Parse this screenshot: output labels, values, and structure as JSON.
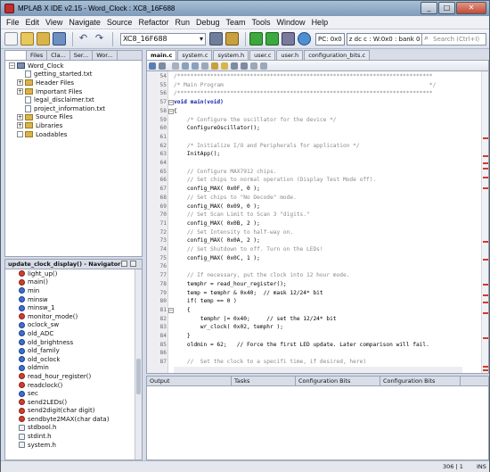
{
  "window": {
    "title": "MPLAB X IDE v2.15 - Word_Clock : XC8_16F688"
  },
  "menu": [
    "File",
    "Edit",
    "View",
    "Navigate",
    "Source",
    "Refactor",
    "Run",
    "Debug",
    "Team",
    "Tools",
    "Window",
    "Help"
  ],
  "toolbar": {
    "config": "XC8_16F688",
    "pc": "PC: 0x0",
    "status": "z dc c  : W:0x0 : bank 0",
    "search_placeholder": "Search (Ctrl+I)"
  },
  "project_tabs": [
    "Files",
    "Cla...",
    "Ser...",
    "Wor..."
  ],
  "project_tree": [
    {
      "label": "Word_Clock",
      "indent": 0,
      "type": "root",
      "exp": "−"
    },
    {
      "label": "getting_started.txt",
      "indent": 2,
      "type": "file"
    },
    {
      "label": "Header Files",
      "indent": 1,
      "type": "folder",
      "exp": "+"
    },
    {
      "label": "Important Files",
      "indent": 1,
      "type": "folder",
      "exp": "+"
    },
    {
      "label": "legal_disclaimer.txt",
      "indent": 2,
      "type": "file"
    },
    {
      "label": "project_information.txt",
      "indent": 2,
      "type": "file"
    },
    {
      "label": "Source Files",
      "indent": 1,
      "type": "folder",
      "exp": "+"
    },
    {
      "label": "Libraries",
      "indent": 1,
      "type": "folder",
      "exp": "+"
    },
    {
      "label": "Loadables",
      "indent": 1,
      "type": "folder",
      "exp": ""
    }
  ],
  "navigator": {
    "title": "update_clock_display() - Navigator",
    "items": [
      {
        "label": "light_up()",
        "kind": "func"
      },
      {
        "label": "main()",
        "kind": "func"
      },
      {
        "label": "min",
        "kind": "var"
      },
      {
        "label": "minsw",
        "kind": "var"
      },
      {
        "label": "minsw_1",
        "kind": "var"
      },
      {
        "label": "monitor_mode()",
        "kind": "func"
      },
      {
        "label": "oclock_sw",
        "kind": "var"
      },
      {
        "label": "old_ADC",
        "kind": "var"
      },
      {
        "label": "old_brightness",
        "kind": "var"
      },
      {
        "label": "old_family",
        "kind": "var"
      },
      {
        "label": "old_oclock",
        "kind": "var"
      },
      {
        "label": "oldmin",
        "kind": "var"
      },
      {
        "label": "read_hour_register()",
        "kind": "func"
      },
      {
        "label": "readclock()",
        "kind": "func"
      },
      {
        "label": "sec",
        "kind": "var"
      },
      {
        "label": "send2LEDs()",
        "kind": "func"
      },
      {
        "label": "send2digit(char digit)",
        "kind": "func"
      },
      {
        "label": "sendbyte2MAX(char data)",
        "kind": "func"
      },
      {
        "label": "stdbool.h",
        "kind": "hfile"
      },
      {
        "label": "stdint.h",
        "kind": "hfile"
      },
      {
        "label": "system.h",
        "kind": "hfile"
      }
    ]
  },
  "editor_tabs": [
    "main.c",
    "system.c",
    "system.h",
    "user.c",
    "user.h",
    "configuration_bits.c"
  ],
  "code_lines": [
    {
      "n": "54",
      "t": "/*****************************************************************************",
      "c": "cm"
    },
    {
      "n": "55",
      "t": "/* Main Program                                                              */",
      "c": "cm"
    },
    {
      "n": "56",
      "t": "/*****************************************************************************",
      "c": "cm"
    },
    {
      "n": "57",
      "t": "void main(void)",
      "c": "kw"
    },
    {
      "n": "58",
      "t": "{",
      "c": ""
    },
    {
      "n": "59",
      "t": "    /* Configure the oscillator for the device */",
      "c": "cm"
    },
    {
      "n": "60",
      "t": "    ConfigureOscillator();",
      "c": ""
    },
    {
      "n": "61",
      "t": "",
      "c": ""
    },
    {
      "n": "62",
      "t": "    /* Initialize I/O and Peripherals for application */",
      "c": "cm"
    },
    {
      "n": "63",
      "t": "    InitApp();",
      "c": ""
    },
    {
      "n": "64",
      "t": "",
      "c": ""
    },
    {
      "n": "65",
      "t": "    // Configure MAX7912 chips.",
      "c": "cm"
    },
    {
      "n": "66",
      "t": "    // Set chips to normal operation (Display Test Mode off).",
      "c": "cm"
    },
    {
      "n": "67",
      "t": "    config_MAX( 0x0F, 0 );",
      "c": ""
    },
    {
      "n": "68",
      "t": "    // Set chips to \"No Decode\" mode.",
      "c": "cm"
    },
    {
      "n": "69",
      "t": "    config_MAX( 0x09, 0 );",
      "c": ""
    },
    {
      "n": "70",
      "t": "    // Set Scan Limit to Scan 3 \"digits.\"",
      "c": "cm"
    },
    {
      "n": "71",
      "t": "    config_MAX( 0x0B, 2 );",
      "c": ""
    },
    {
      "n": "72",
      "t": "    // Set Intensity to half-way on.",
      "c": "cm"
    },
    {
      "n": "73",
      "t": "    config_MAX( 0x0A, 2 );",
      "c": ""
    },
    {
      "n": "74",
      "t": "    // Set Shutdown to off. Turn on the LEDs!",
      "c": "cm"
    },
    {
      "n": "75",
      "t": "    config_MAX( 0x0C, 1 );",
      "c": ""
    },
    {
      "n": "76",
      "t": "",
      "c": ""
    },
    {
      "n": "77",
      "t": "    // If necessary, put the clock into 12 hour mode.",
      "c": "cm"
    },
    {
      "n": "78",
      "t": "    temphr = read_hour_register();",
      "c": ""
    },
    {
      "n": "79",
      "t": "    temp = temphr & 0x40;  // mask 12/24* bit",
      "c": ""
    },
    {
      "n": "80",
      "t": "    if( temp == 0 )",
      "c": ""
    },
    {
      "n": "81",
      "t": "    {",
      "c": ""
    },
    {
      "n": "82",
      "t": "        temphr |= 0x40;     // set the 12/24* bit",
      "c": ""
    },
    {
      "n": "83",
      "t": "        wr_clock( 0x02, temphr );",
      "c": ""
    },
    {
      "n": "84",
      "t": "    }",
      "c": ""
    },
    {
      "n": "85",
      "t": "    oldmin = 62;   // Force the first LED update. Later comparison will fail.",
      "c": ""
    },
    {
      "n": "86",
      "t": "",
      "c": ""
    },
    {
      "n": "87",
      "t": "    //  Set the clock to a specifi time, if desired, here)",
      "c": "cm"
    }
  ],
  "output_tabs": [
    "Output",
    "Tasks",
    "Configuration Bits",
    "Configuration Bits"
  ],
  "status": {
    "pos": "306 | 1",
    "mode": "INS"
  }
}
